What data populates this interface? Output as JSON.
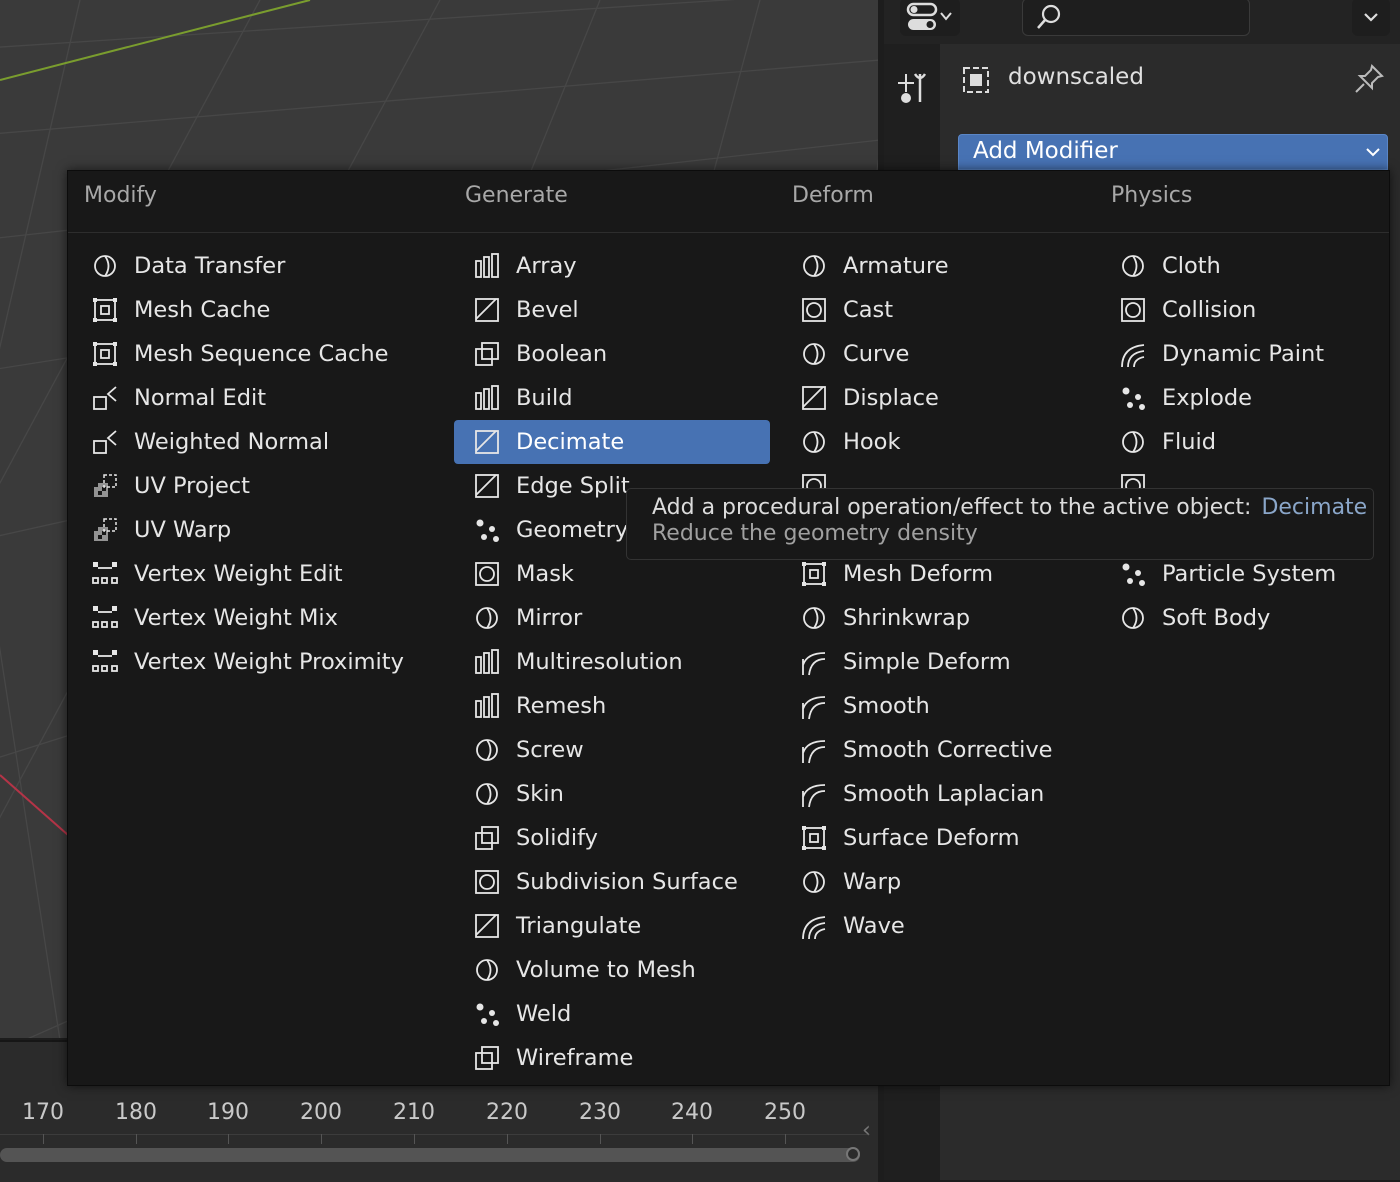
{
  "colors": {
    "accent": "#4772b3",
    "menu_bg": "#181818",
    "viewport_bg": "#3a3a3a",
    "python_text": "#8aa6c9"
  },
  "properties": {
    "object_name": "downscaled",
    "add_modifier_label": "Add Modifier",
    "icons": {
      "editor_type": "editor-type-icon",
      "search": "search-icon",
      "options": "chevron-down-icon",
      "tool_tab": "tool-icon",
      "render_tab": "render-icon",
      "object": "object-data-icon",
      "pin": "pin-icon"
    }
  },
  "menu": {
    "columns": [
      {
        "heading": "Modify",
        "items": [
          {
            "label": "Data Transfer",
            "icon": "data-transfer-icon"
          },
          {
            "label": "Mesh Cache",
            "icon": "mesh-cache-icon"
          },
          {
            "label": "Mesh Sequence Cache",
            "icon": "mesh-sequence-cache-icon"
          },
          {
            "label": "Normal Edit",
            "icon": "normal-edit-icon"
          },
          {
            "label": "Weighted Normal",
            "icon": "weighted-normal-icon"
          },
          {
            "label": "UV Project",
            "icon": "uv-project-icon"
          },
          {
            "label": "UV Warp",
            "icon": "uv-warp-icon"
          },
          {
            "label": "Vertex Weight Edit",
            "icon": "vertex-weight-edit-icon"
          },
          {
            "label": "Vertex Weight Mix",
            "icon": "vertex-weight-mix-icon"
          },
          {
            "label": "Vertex Weight Proximity",
            "icon": "vertex-weight-proximity-icon"
          }
        ]
      },
      {
        "heading": "Generate",
        "items": [
          {
            "label": "Array",
            "icon": "array-icon"
          },
          {
            "label": "Bevel",
            "icon": "bevel-icon"
          },
          {
            "label": "Boolean",
            "icon": "boolean-icon"
          },
          {
            "label": "Build",
            "icon": "build-icon"
          },
          {
            "label": "Decimate",
            "icon": "decimate-icon",
            "active": true
          },
          {
            "label": "Edge Split",
            "icon": "edge-split-icon"
          },
          {
            "label": "Geometry",
            "icon": "geometry-nodes-icon"
          },
          {
            "label": "Mask",
            "icon": "mask-icon"
          },
          {
            "label": "Mirror",
            "icon": "mirror-icon"
          },
          {
            "label": "Multiresolution",
            "icon": "multiresolution-icon"
          },
          {
            "label": "Remesh",
            "icon": "remesh-icon"
          },
          {
            "label": "Screw",
            "icon": "screw-icon"
          },
          {
            "label": "Skin",
            "icon": "skin-icon"
          },
          {
            "label": "Solidify",
            "icon": "solidify-icon"
          },
          {
            "label": "Subdivision Surface",
            "icon": "subdivision-surface-icon"
          },
          {
            "label": "Triangulate",
            "icon": "triangulate-icon"
          },
          {
            "label": "Volume to Mesh",
            "icon": "volume-to-mesh-icon"
          },
          {
            "label": "Weld",
            "icon": "weld-icon"
          },
          {
            "label": "Wireframe",
            "icon": "wireframe-icon"
          }
        ]
      },
      {
        "heading": "Deform",
        "items": [
          {
            "label": "Armature",
            "icon": "armature-icon"
          },
          {
            "label": "Cast",
            "icon": "cast-icon"
          },
          {
            "label": "Curve",
            "icon": "curve-icon"
          },
          {
            "label": "Displace",
            "icon": "displace-icon"
          },
          {
            "label": "Hook",
            "icon": "hook-icon"
          },
          {
            "label": "",
            "icon": "lattice-icon"
          },
          {
            "label": "",
            "icon": "hidden-icon"
          },
          {
            "label": "Mesh Deform",
            "icon": "mesh-deform-icon"
          },
          {
            "label": "Shrinkwrap",
            "icon": "shrinkwrap-icon"
          },
          {
            "label": "Simple Deform",
            "icon": "simple-deform-icon"
          },
          {
            "label": "Smooth",
            "icon": "smooth-icon"
          },
          {
            "label": "Smooth Corrective",
            "icon": "smooth-corrective-icon"
          },
          {
            "label": "Smooth Laplacian",
            "icon": "smooth-laplacian-icon"
          },
          {
            "label": "Surface Deform",
            "icon": "surface-deform-icon"
          },
          {
            "label": "Warp",
            "icon": "warp-icon"
          },
          {
            "label": "Wave",
            "icon": "wave-icon"
          }
        ]
      },
      {
        "heading": "Physics",
        "items": [
          {
            "label": "Cloth",
            "icon": "cloth-icon"
          },
          {
            "label": "Collision",
            "icon": "collision-icon"
          },
          {
            "label": "Dynamic Paint",
            "icon": "dynamic-paint-icon"
          },
          {
            "label": "Explode",
            "icon": "explode-icon"
          },
          {
            "label": "Fluid",
            "icon": "fluid-icon"
          },
          {
            "label": "",
            "icon": "ocean-icon"
          },
          {
            "label": "",
            "icon": "hidden-icon"
          },
          {
            "label": "Particle System",
            "icon": "particle-system-icon"
          },
          {
            "label": "Soft Body",
            "icon": "soft-body-icon"
          }
        ]
      }
    ]
  },
  "tooltip": {
    "line1": "Add a procedural operation/effect to the active object:",
    "python": "Decimate",
    "line2": "Reduce the geometry density"
  },
  "timeline": {
    "frames": [
      "170",
      "180",
      "190",
      "200",
      "210",
      "220",
      "230",
      "240",
      "250"
    ]
  }
}
